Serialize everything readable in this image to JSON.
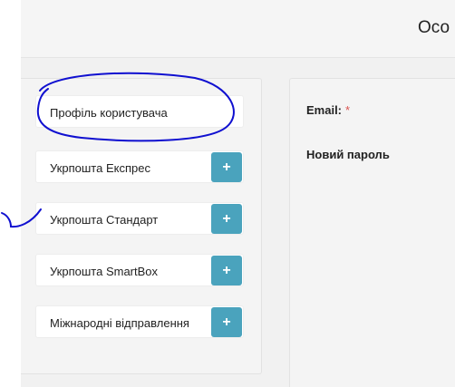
{
  "header": {
    "title": "Осо"
  },
  "sidebar": {
    "items": [
      {
        "label": "Профіль користувача",
        "has_add": false
      },
      {
        "label": "Укрпошта Експрес",
        "has_add": true
      },
      {
        "label": "Укрпошта Стандарт",
        "has_add": true
      },
      {
        "label": "Укрпошта SmartBox",
        "has_add": true
      },
      {
        "label": "Міжнародні відправлення",
        "has_add": true
      }
    ],
    "add_button_label": "+"
  },
  "form": {
    "email_label": "Email:",
    "required_mark": "*",
    "new_password_label": "Новий пароль"
  },
  "colors": {
    "accent": "#4aa3bd",
    "required": "#d9534f",
    "annotation": "#1010d0"
  }
}
